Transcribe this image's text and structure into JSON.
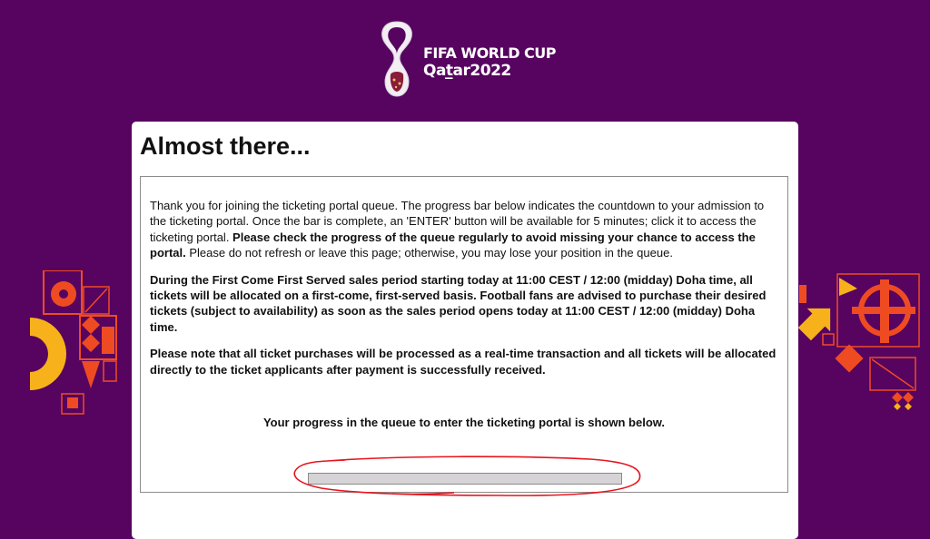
{
  "logo": {
    "line1": "FIFA WORLD CUP",
    "line2": "Qat̲ar2022",
    "emblem": "trophy-emblem"
  },
  "card": {
    "title": "Almost there...",
    "paragraph1": {
      "text_a": "Thank you for joining the ticketing portal queue. The progress bar below indicates the countdown to your admission to the ticketing portal. Once the bar is complete, an 'ENTER' button will be available for 5 minutes; click it to access the ticketing portal. ",
      "bold": "Please check the progress of the queue regularly to avoid missing your chance to access the portal.",
      "text_b": " Please do not refresh or leave this page; otherwise, you may lose your position in the queue."
    },
    "paragraph2": "During the First Come First Served sales period starting today at 11:00 CEST / 12:00 (midday) Doha time, all tickets will be allocated on a first-come, first-served basis. Football fans are advised to purchase their desired tickets (subject to availability) as soon as the sales period opens today at 11:00 CEST / 12:00 (midday) Doha time.",
    "paragraph3": "Please note that all ticket purchases will be processed as a real-time transaction and all tickets will be allocated directly to the ticket applicants after payment is successfully received.",
    "progress_caption": "Your progress in the queue to enter the ticketing portal is shown below.",
    "progress_fraction": 0
  },
  "colors": {
    "background": "#56045f",
    "card": "#ffffff",
    "progress_track": "#d6d3d6",
    "annotation": "#e8141d",
    "pattern_orange": "#ef4b23",
    "pattern_yellow": "#f7b21b"
  }
}
